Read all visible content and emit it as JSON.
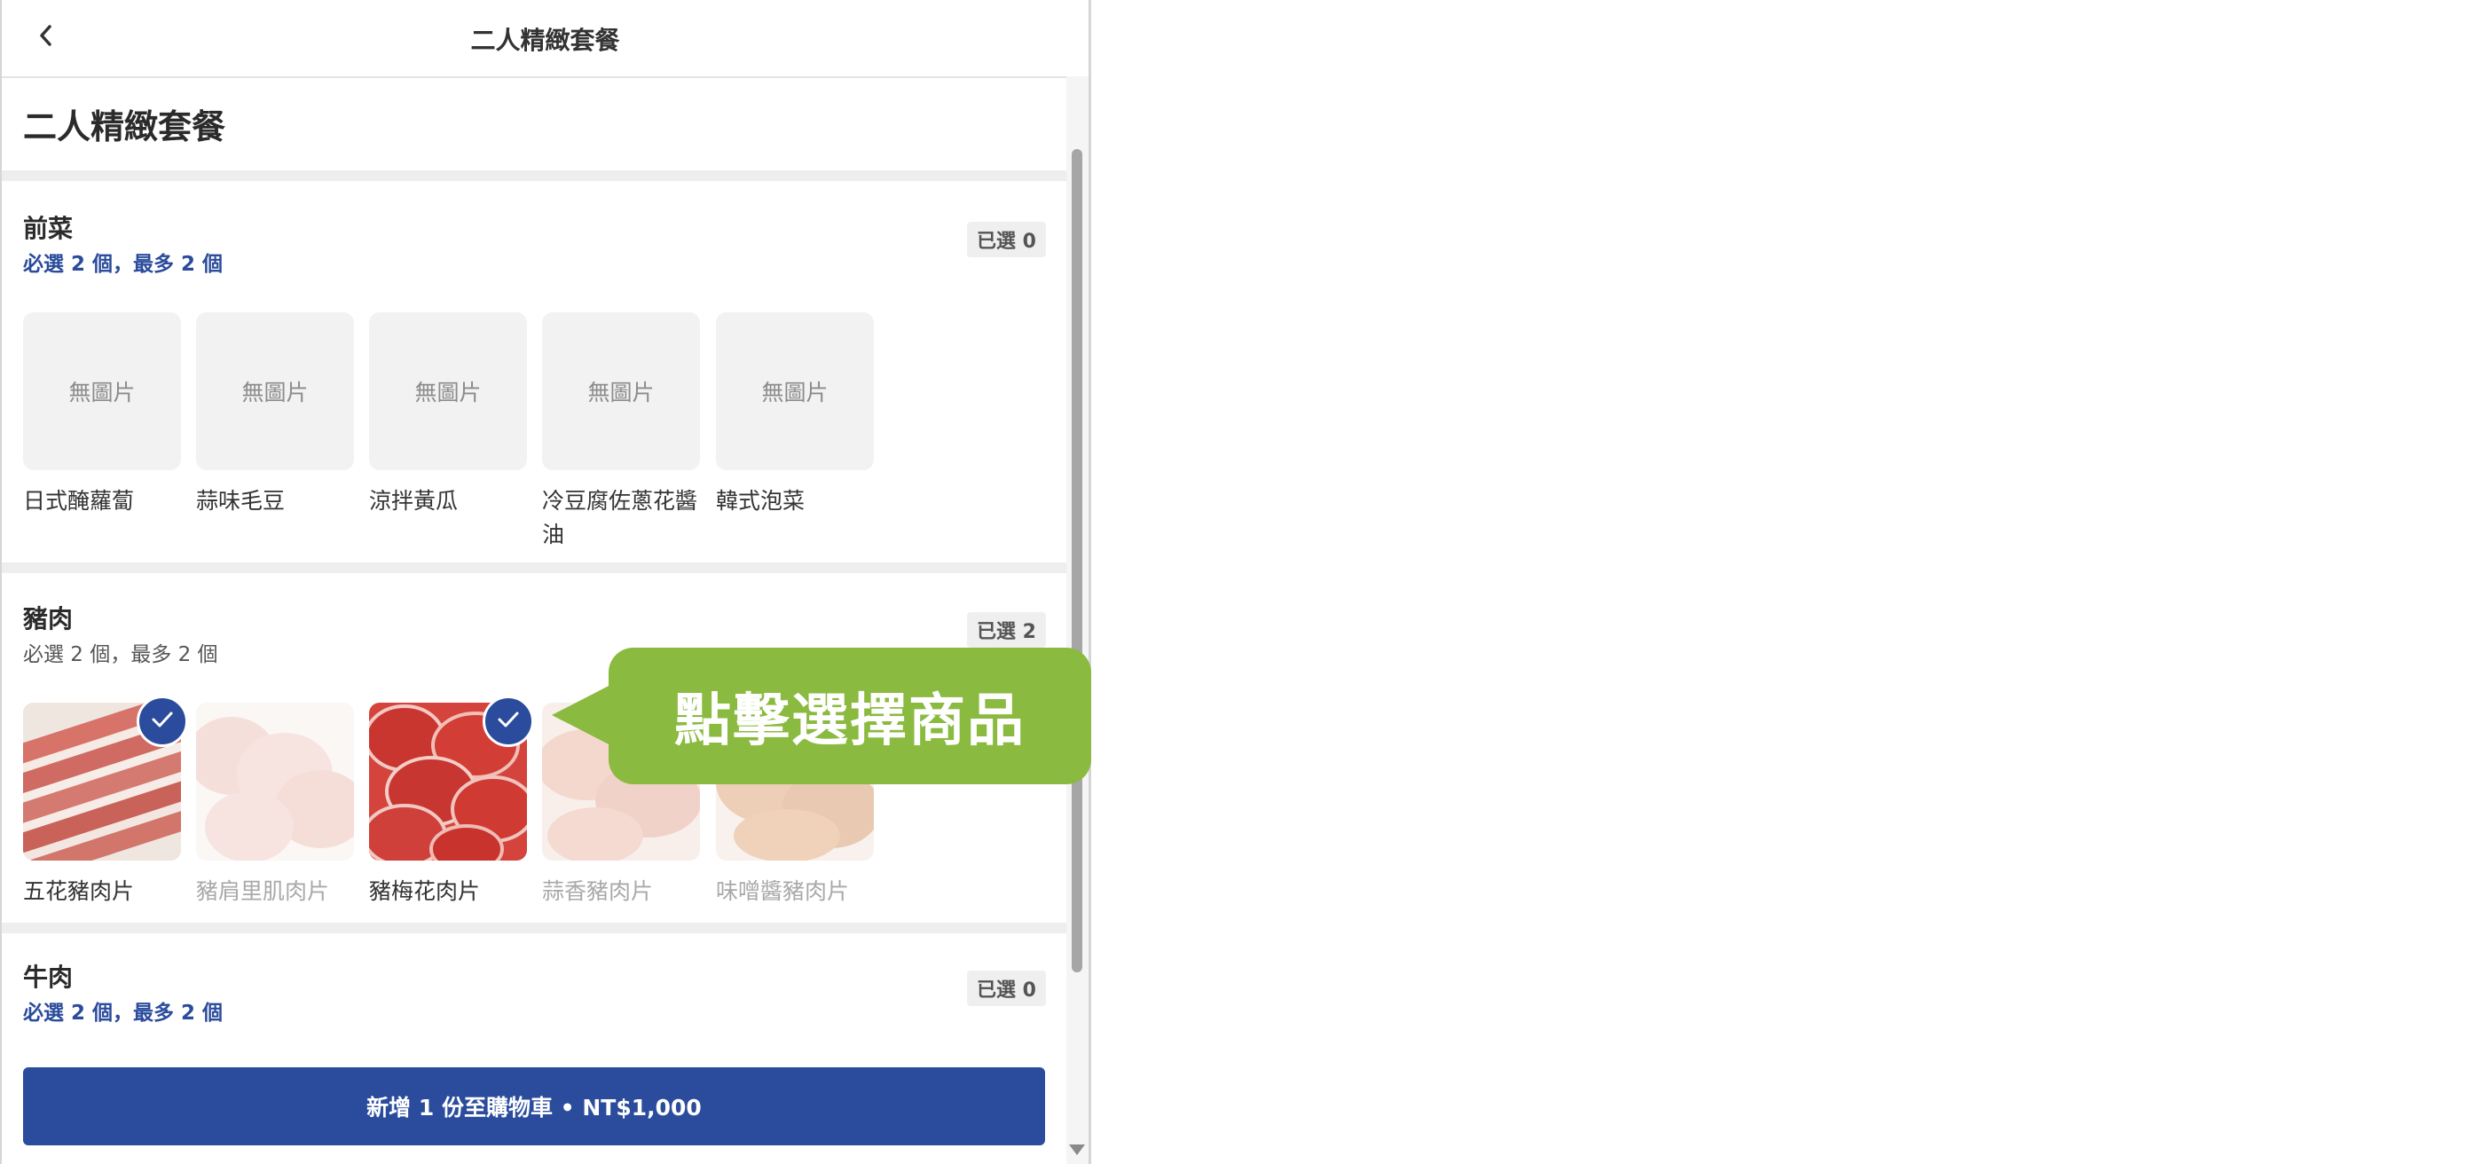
{
  "header": {
    "title": "二人精緻套餐",
    "back_icon": "chevron-left-icon"
  },
  "page_title": "二人精緻套餐",
  "sections": [
    {
      "name": "前菜",
      "rule": "必選 2 個，最多 2 個",
      "selected_label": "已選 0",
      "items": [
        {
          "name": "日式醃蘿蔔",
          "image_placeholder": "無圖片"
        },
        {
          "name": "蒜味毛豆",
          "image_placeholder": "無圖片"
        },
        {
          "name": "涼拌黃瓜",
          "image_placeholder": "無圖片"
        },
        {
          "name": "冷豆腐佐蔥花醬油",
          "image_placeholder": "無圖片"
        },
        {
          "name": "韓式泡菜",
          "image_placeholder": "無圖片"
        }
      ]
    },
    {
      "name": "豬肉",
      "rule": "必選 2 個，最多 2 個",
      "selected_label": "已選 2",
      "items": [
        {
          "name": "五花豬肉片",
          "selected": true
        },
        {
          "name": "豬肩里肌肉片",
          "selected": false
        },
        {
          "name": "豬梅花肉片",
          "selected": true
        },
        {
          "name": "蒜香豬肉片",
          "selected": false
        },
        {
          "name": "味噌醬豬肉片",
          "selected": false
        }
      ]
    },
    {
      "name": "牛肉",
      "rule": "必選 2 個，最多 2 個",
      "selected_label": "已選 0"
    }
  ],
  "add_to_cart": {
    "label": "新增 1 份至購物車 • NT$1,000"
  },
  "callout": {
    "text": "點擊選擇商品"
  },
  "colors": {
    "primary": "#2b4c9c",
    "callout": "#8aba3f"
  }
}
